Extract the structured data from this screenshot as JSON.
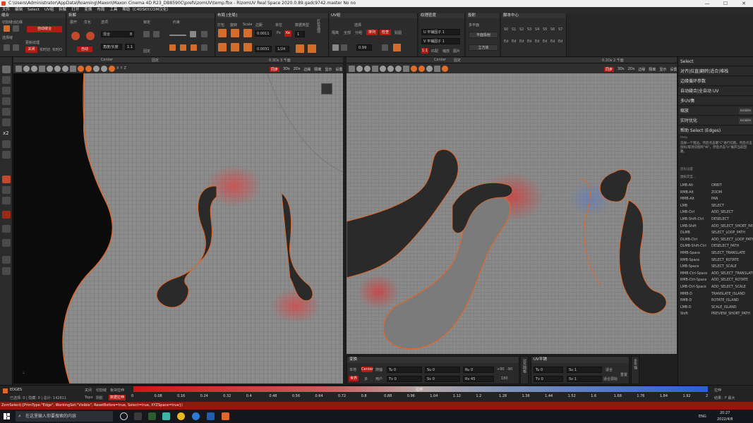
{
  "window": {
    "title": "C:\\Users\\Administrator\\AppData\\Roaming\\Maxon\\Maxon Cinema 4D R23_DB8590C\\prefs\\zomUV\\temp.fbx - RizomUV  Real Space 2020.0.89.gadc9742.master No no",
    "minimize": "—",
    "maximize": "☐",
    "close": "✕"
  },
  "menu": [
    "文件",
    "编辑",
    "Select",
    "UV组",
    "拆解",
    "打开",
    "变换",
    "布局",
    "工具",
    "帮助（C4DSKY.COM汉化）"
  ],
  "toolbar": {
    "seams": {
      "title": "缝合",
      "items": [
        "切割缝合",
        "边缘",
        "选择缝",
        "更新纹理",
        "关闭",
        "实时切",
        "实时O"
      ],
      "red_btn": "自动缝合"
    },
    "unfold": {
      "title": "拆解",
      "labels": [
        "展开",
        "优化",
        "选项",
        "锁定",
        "约束",
        "固定"
      ],
      "value1": "混合",
      "value2": "角度/长度",
      "value3": "1:1",
      "value4": "8",
      "red_btn": "自动"
    },
    "layout": {
      "title": "布局 [全局]",
      "labels": [
        "打包",
        "旋转",
        "Scale",
        "边距",
        "单位",
        "数据类型"
      ],
      "v1": "0.0011",
      "v2": "0.0031",
      "v3": "1/24",
      "v4": "1"
    },
    "uvgroup": {
      "title": "UV组",
      "labels": [
        "选择",
        "隔离",
        "全部",
        "分组",
        "排列",
        "检查",
        "贴图"
      ],
      "v1": "0.99"
    },
    "texel": {
      "title": "纹理密度",
      "labels": [
        "U 平铺因子",
        "V 平铺因子",
        "匹配",
        "缩放",
        "图片"
      ],
      "u": "1",
      "v": "1"
    },
    "projection": {
      "title": "投射",
      "labels": [
        "多平面",
        "平面投射",
        "立方体"
      ]
    },
    "script": {
      "title": "脚本中心",
      "labels": [
        "S0",
        "S1",
        "S2",
        "S3",
        "S4",
        "S5",
        "S6",
        "S7",
        "Ed",
        "Ed",
        "Ed",
        "Ed",
        "Ed",
        "Ed",
        "Ed",
        "Ed"
      ]
    }
  },
  "left_tools": [
    "Select",
    "Move",
    "Rotate",
    "Scale",
    "x2",
    "Pin",
    "Prim",
    "Cut",
    "Weld",
    "Flatten",
    "Relax",
    "Spin",
    "Loop",
    "Ring"
  ],
  "viewport3d": {
    "label_center": "Center",
    "label_pins": "固定",
    "tabs": [
      "同步",
      "3Ds",
      "2Ds",
      "边缘",
      "隔离",
      "显示",
      "设置"
    ],
    "sub": "0.3Ds 3 千面",
    "axis": [
      "X",
      "Y",
      "Z"
    ]
  },
  "viewportuv": {
    "label_center": "Center",
    "label_pins": "固定",
    "tabs": [
      "同步",
      "3Ds",
      "2Ds",
      "边缘",
      "隔离",
      "显示",
      "设置"
    ],
    "sub": "0.2Ds 2 千面"
  },
  "right_panel": {
    "sections": [
      {
        "label": "Select",
        "enable": ""
      },
      {
        "label": "对齐|拉直|翻转|适合|堆栈",
        "enable": ""
      },
      {
        "label": "边缘循环参数",
        "enable": ""
      },
      {
        "label": "自动缝合|全自动 UV",
        "enable": ""
      },
      {
        "label": "多UV集",
        "enable": ""
      },
      {
        "label": "缩放",
        "enable": "enable"
      },
      {
        "label": "实时优化",
        "enable": "enable"
      },
      {
        "label": "帮助 Select (Edges)",
        "enable": ""
      }
    ],
    "help_title": "Help",
    "help_text": "选择一个阻边。然后点击键\"C\"进行切割。然后点击鼠标/取消切割的\"W\"。然后点击\"U\"展开当前回路。",
    "mouse_title": "鼠标设置",
    "mouse_sub": "鼠标交互...",
    "shortcuts": [
      [
        "LMB-Alt",
        "ORBIT"
      ],
      [
        "RMB-Alt",
        "ZOOM"
      ],
      [
        "MMB-Alt",
        "PAN"
      ],
      [
        "LMB",
        "SELECT"
      ],
      [
        "LMB-Ctrl",
        "ADD_SELECT"
      ],
      [
        "LMB-Shift-Ctrl",
        "DESELECT"
      ],
      [
        "LMB-Shift",
        "ADD_SELECT_SHORT_PATH"
      ],
      [
        "DLMB",
        "SELECT_LOOP_PATH"
      ],
      [
        "DLMB-Ctrl",
        "ADD_SELECT_LOOP_PATH"
      ],
      [
        "DLMB-Shift-Ctrl",
        "DESELECT_PATH"
      ],
      [
        "MMB-Space",
        "SELECT_TRANSLATE"
      ],
      [
        "RMB-Space",
        "SELECT_ROTATE"
      ],
      [
        "LMB-Space",
        "SELECT_SCALE"
      ],
      [
        "MMB-Ctrl-Space",
        "ADD_SELECT_TRANSLATE"
      ],
      [
        "RMB-Ctrl-Space",
        "ADD_SELECT_ROTATE"
      ],
      [
        "LMB-Ctrl-Space",
        "ADD_SELECT_SCALE"
      ],
      [
        "MMB-D",
        "TRANSLATE_ISLAND"
      ],
      [
        "RMB-D",
        "ROTATE_ISLAND"
      ],
      [
        "LMB-D",
        "SCALE_ISLAND"
      ],
      [
        "Shift",
        "PREVIEW_SHORT_PATH"
      ]
    ]
  },
  "transform_panel": {
    "title": "变换",
    "row1": [
      "本地",
      "Center",
      "随轴"
    ],
    "row2": [
      "世界",
      "多",
      "用户"
    ],
    "tu": "Tu 0",
    "tv": "Tv 0",
    "su": "Su 0",
    "sv": "Sv 0",
    "ru": "Ru 0",
    "rv": "Rv 45",
    "p90": "+90",
    "m90": "-90",
    "r180": "180",
    "side": "对齐网格"
  },
  "uvtile_panel": {
    "title": "UV平铺",
    "tu": "Tu 0",
    "tv": "Tv 0",
    "su": "Su 1",
    "sv": "Sv 1",
    "fit": "适合",
    "fitgrid": "适合源始",
    "reset": "重置",
    "side": "多平铺"
  },
  "status": {
    "mode": "EDGES",
    "info": "已选择: 0 | 隐藏: 0 | 总计: 142811",
    "btn1": "关闭",
    "btn2": "切割缝",
    "btn3": "板块拉伸",
    "topo": "Topo",
    "topo_opt": "阴影",
    "topo_opt2": "数据拉伸",
    "grad_label": "拉伸",
    "ticks": [
      "0",
      "0.08",
      "0.16",
      "0.24",
      "0.32",
      "0.4",
      "0.48",
      "0.56",
      "0.64",
      "0.72",
      "0.8",
      "0.88",
      "0.96",
      "1.04",
      "1.12",
      "1.2",
      "1.28",
      "1.36",
      "1.44",
      "1.52",
      "1.6",
      "1.68",
      "1.76",
      "1.84",
      "1.92",
      "2"
    ],
    "right1": "拉伸",
    "right2": "结果：F 最大"
  },
  "command_line": "ZomSelect({PrimType:\"Edge\", WorkingSet:\"Visible\", ResetBefore=true, Select=true, XYZSpace=true})",
  "taskbar": {
    "search_placeholder": "在这里输入你要搜索的内容",
    "time": "20:27",
    "date": "2022/4/8",
    "lang": "ENG"
  },
  "colors": {
    "accent_red": "#b31a12",
    "uv_bg": "#8a8a8a",
    "seam_orange": "#e0662a"
  }
}
